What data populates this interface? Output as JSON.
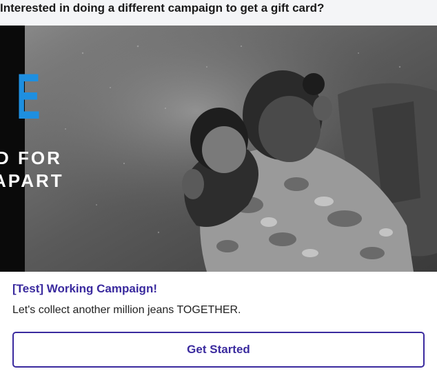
{
  "header": {
    "title": "Interested in doing a different campaign to get a gift card?"
  },
  "campaign": {
    "hero_big_letter": "E",
    "hero_line_1": "D FOR",
    "hero_line_2": "APART",
    "title": "[Test] Working Campaign!",
    "description": "Let's collect another million jeans TOGETHER.",
    "button_label": "Get Started"
  },
  "colors": {
    "accent": "#3a2a9e",
    "hero_blue": "#1e8fe0"
  }
}
